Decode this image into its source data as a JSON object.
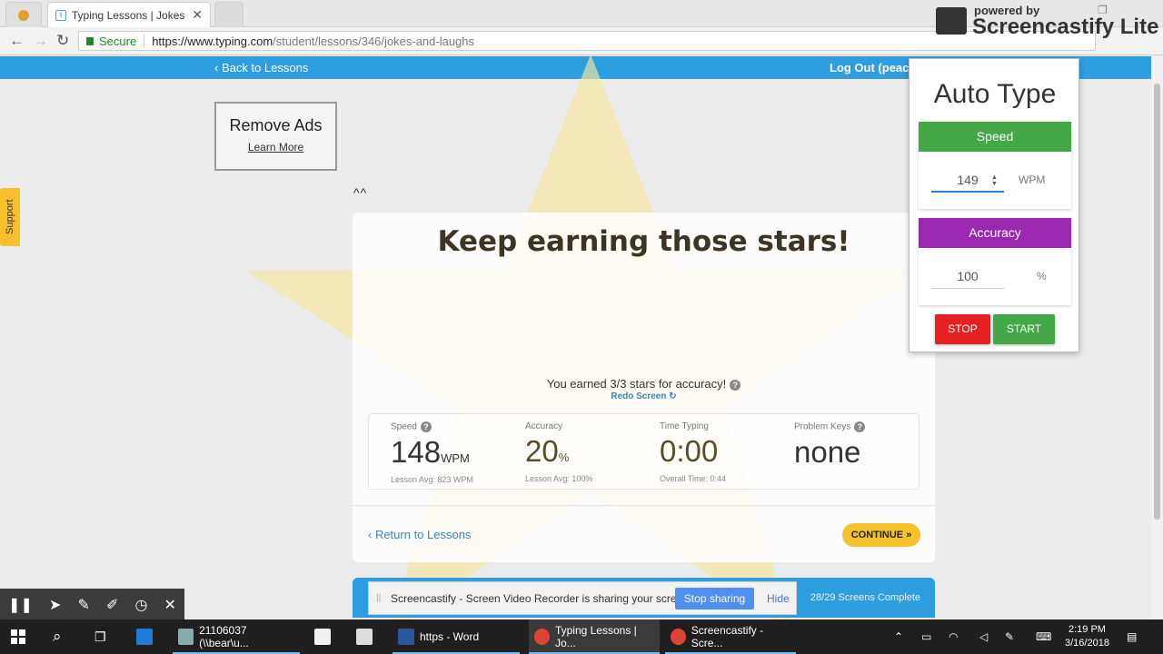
{
  "browser": {
    "tab_title": "Typing Lessons | Jokes ar",
    "tab_close": "✕",
    "secure_label": "Secure",
    "url_host": "https://www.typing.com",
    "url_path": "/student/lessons/346/jokes-and-laughs"
  },
  "site_nav": {
    "back_label": "‹ Back to Lessons",
    "logout_label": "Log Out (peac"
  },
  "support_label": "Support",
  "ads": {
    "title": "Remove Ads",
    "link": "Learn More"
  },
  "caret_text": "^^",
  "results": {
    "headline": "Keep earning those stars!",
    "earned_text": "You earned 3/3 stars for accuracy!",
    "redo_label": "Redo Screen ↻",
    "stats": [
      {
        "label": "Speed",
        "value": "148",
        "unit": "WPM",
        "sub": "Lesson Avg: 823 WPM"
      },
      {
        "label": "Accuracy",
        "value": "20",
        "unit": "%",
        "sub": "Lesson Avg: 100%"
      },
      {
        "label": "Time Typing",
        "value": "0:00",
        "unit": "",
        "sub": "Overall Time: 0:44"
      },
      {
        "label": "Problem Keys",
        "value": "none",
        "unit": "",
        "sub": ""
      }
    ],
    "return_label": "‹ Return to Lessons",
    "continue_label": "CONTINUE »"
  },
  "progress": {
    "screens_complete": "28/29 Screens Complete"
  },
  "sharebar": {
    "message": "Screencastify - Screen Video Recorder is sharing your screen.",
    "stop_label": "Stop sharing",
    "hide_label": "Hide"
  },
  "autotype": {
    "title": "Auto Type",
    "speed_header": "Speed",
    "speed_value": "149",
    "speed_unit": "WPM",
    "accuracy_header": "Accuracy",
    "accuracy_value": "100",
    "accuracy_unit": "%",
    "stop_label": "STOP",
    "start_label": "START",
    "colors": {
      "speed": "#43a845",
      "accuracy": "#9c27b0",
      "stop": "#e52020",
      "start": "#43a845"
    }
  },
  "watermark": {
    "powered_by": "powered by",
    "name": "Screencastify Lite"
  },
  "taskbar": {
    "items": [
      {
        "label": "21106037 (\\\\bear\\u..."
      },
      {
        "label": "https - Word"
      },
      {
        "label": "Typing Lessons | Jo..."
      },
      {
        "label": "Screencastify - Scre..."
      }
    ],
    "time": "2:19 PM",
    "date": "3/16/2018"
  }
}
